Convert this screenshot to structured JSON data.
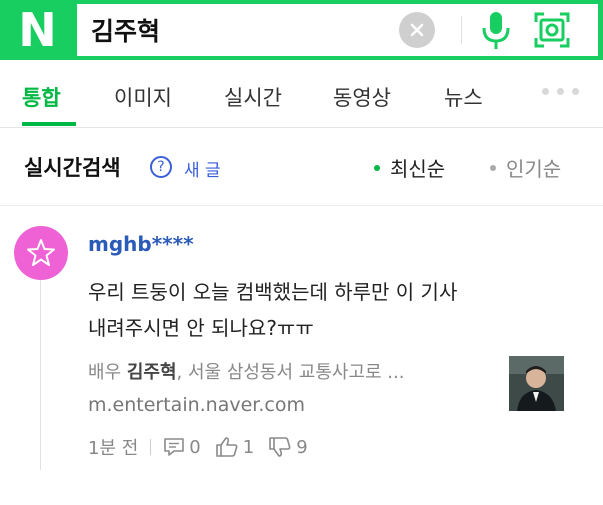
{
  "search": {
    "logo_letter": "N",
    "query": "김주혁"
  },
  "tabs": [
    {
      "label": "통합",
      "active": true
    },
    {
      "label": "이미지"
    },
    {
      "label": "실시간"
    },
    {
      "label": "동영상"
    },
    {
      "label": "뉴스"
    }
  ],
  "section": {
    "title": "실시간검색",
    "help_icon_text": "?",
    "new_posts_label": "새 글",
    "sort_latest": "최신순",
    "sort_popular": "인기순"
  },
  "post": {
    "username": "mghb****",
    "body_line1": "우리 트둥이 오늘 컴백했는데 하루만 이 기사",
    "body_line2": "내려주시면 안 되나요?ㅠㅠ",
    "link_prefix": "배우 ",
    "link_bold": "김주혁",
    "link_suffix": ", 서울 삼성동서 교통사고로 ...",
    "link_url": "m.entertain.naver.com",
    "time": "1분 전",
    "comments": "0",
    "likes": "1",
    "dislikes": "9"
  },
  "colors": {
    "brand_green": "#19ce60",
    "active_tab": "#00b843",
    "username_blue": "#2b5bb8",
    "avatar_pink": "#ee62d6"
  }
}
